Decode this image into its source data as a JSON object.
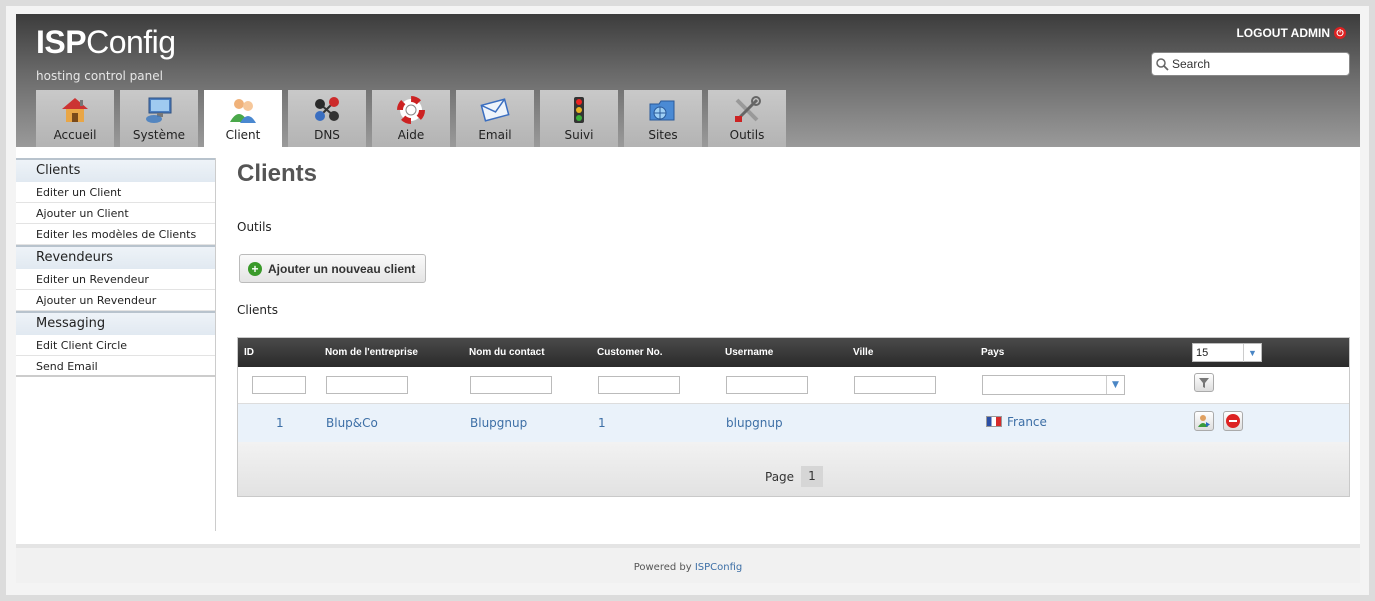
{
  "header": {
    "logo_bold": "ISP",
    "logo_rest": "Config",
    "tagline": "hosting control panel",
    "logout": "LOGOUT ADMIN",
    "search_placeholder": "Search"
  },
  "tabs": [
    {
      "label": "Accueil",
      "icon": "home-icon"
    },
    {
      "label": "Système",
      "icon": "computer-icon"
    },
    {
      "label": "Client",
      "icon": "users-icon",
      "active": true
    },
    {
      "label": "DNS",
      "icon": "network-icon"
    },
    {
      "label": "Aide",
      "icon": "lifebuoy-icon"
    },
    {
      "label": "Email",
      "icon": "envelope-icon"
    },
    {
      "label": "Suivi",
      "icon": "traffic-light-icon"
    },
    {
      "label": "Sites",
      "icon": "folder-globe-icon"
    },
    {
      "label": "Outils",
      "icon": "tools-icon"
    }
  ],
  "sidebar": {
    "sections": [
      {
        "title": "Clients",
        "items": [
          "Editer un Client",
          "Ajouter un Client",
          "Editer les modèles de Clients"
        ]
      },
      {
        "title": "Revendeurs",
        "items": [
          "Editer un Revendeur",
          "Ajouter un Revendeur"
        ]
      },
      {
        "title": "Messaging",
        "items": [
          "Edit Client Circle",
          "Send Email"
        ]
      }
    ]
  },
  "main": {
    "title": "Clients",
    "tools_label": "Outils",
    "add_button": "Ajouter un nouveau client",
    "list_label": "Clients",
    "columns": [
      "ID",
      "Nom de l'entreprise",
      "Nom du contact",
      "Customer No.",
      "Username",
      "Ville",
      "Pays"
    ],
    "page_size": "15",
    "rows": [
      {
        "id": "1",
        "company": "Blup&Co",
        "contact": "Blupgnup",
        "customer_no": "1",
        "username": "blupgnup",
        "city": "",
        "country": "France"
      }
    ],
    "pager_label": "Page",
    "pager_current": "1"
  },
  "footer": {
    "prefix": "Powered by",
    "brand": "ISPConfig"
  },
  "colors": {
    "link": "#3d6fa6",
    "row_highlight": "#eaf2fa",
    "header_dark": "#2a2a2a"
  }
}
